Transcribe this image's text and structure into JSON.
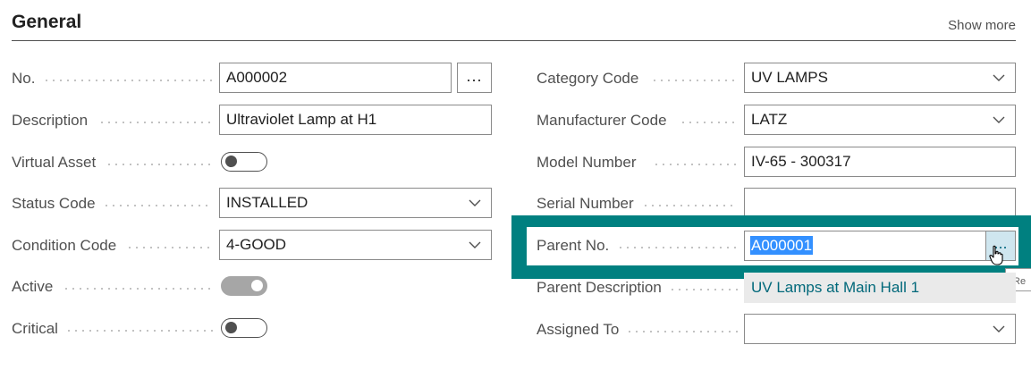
{
  "section": {
    "title": "General",
    "show_more": "Show more"
  },
  "left": {
    "no": {
      "label": "No.",
      "value": "A000002"
    },
    "description": {
      "label": "Description",
      "value": "Ultraviolet Lamp at H1"
    },
    "virtual_asset": {
      "label": "Virtual Asset",
      "on": false
    },
    "status_code": {
      "label": "Status Code",
      "value": "INSTALLED"
    },
    "condition_code": {
      "label": "Condition Code",
      "value": "4-GOOD"
    },
    "active": {
      "label": "Active",
      "on": true
    },
    "critical": {
      "label": "Critical",
      "on": false
    }
  },
  "right": {
    "category_code": {
      "label": "Category Code",
      "value": "UV LAMPS"
    },
    "manufacturer_code": {
      "label": "Manufacturer Code",
      "value": "LATZ"
    },
    "model_number": {
      "label": "Model Number",
      "value": "IV-65 - 300317"
    },
    "serial_number": {
      "label": "Serial Number",
      "value": ""
    },
    "parent_no": {
      "label": "Parent No.",
      "value": "A000001"
    },
    "parent_description": {
      "label": "Parent Description",
      "value": "UV Lamps at Main Hall 1"
    },
    "assigned_to": {
      "label": "Assigned To",
      "value": ""
    }
  },
  "assist_button_label": "...",
  "tooltip_text": "Re",
  "colors": {
    "focus_frame": "#008080",
    "link_text": "#00687a",
    "selection": "#3390ff"
  },
  "icons": {
    "dropdown": "chevron-down-icon",
    "cursor": "hand-pointer-icon"
  }
}
